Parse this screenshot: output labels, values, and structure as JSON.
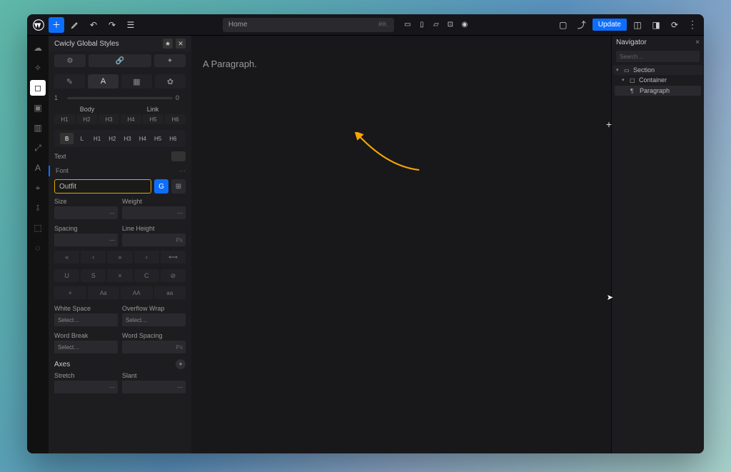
{
  "topbar": {
    "url_label": "Home",
    "url_badge": "##.",
    "update_label": "Update"
  },
  "panel": {
    "title": "Cwicly Global Styles",
    "slider": {
      "min": "1",
      "max": "0"
    },
    "body_label": "Body",
    "link_label": "Link",
    "headings": [
      "H1",
      "H2",
      "H3",
      "H4",
      "H5",
      "H6"
    ],
    "bl": [
      "B",
      "L",
      "H1",
      "H2",
      "H3",
      "H4",
      "H5",
      "H6"
    ],
    "text_label": "Text",
    "font_section": "Font",
    "font_value": "Outfit",
    "google_label": "G",
    "size_label": "Size",
    "weight_label": "Weight",
    "spacing_label": "Spacing",
    "lineheight_label": "Line Height",
    "lineheight_unit": "Px",
    "style_icons": [
      "«",
      "‹",
      "»",
      "›",
      "⟷"
    ],
    "deco_icons": [
      "U",
      "S",
      "×",
      "C",
      "⊘"
    ],
    "case_icons": [
      "×",
      "Aa",
      "AA",
      "aa"
    ],
    "whitespace_label": "White Space",
    "overflowwrap_label": "Overflow Wrap",
    "wordbreak_label": "Word Break",
    "wordspacing_label": "Word Spacing",
    "wordspacing_unit": "Px",
    "select_ph": "Select…",
    "axes_label": "Axes",
    "stretch_label": "Stretch",
    "slant_label": "Slant",
    "unit_dash": "—"
  },
  "canvas": {
    "paragraph": "A Paragraph."
  },
  "navigator": {
    "title": "Navigator",
    "search_ph": "Search…",
    "items": {
      "section": "Section",
      "container": "Container",
      "paragraph": "Paragraph"
    }
  }
}
